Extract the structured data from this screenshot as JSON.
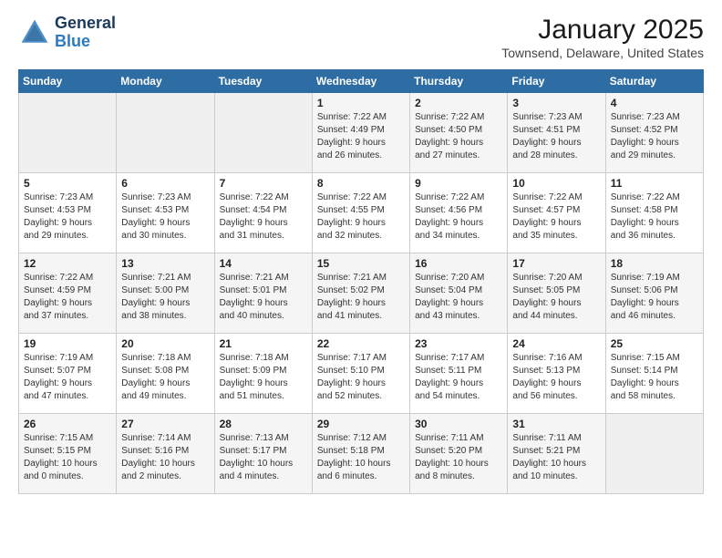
{
  "header": {
    "logo_general": "General",
    "logo_blue": "Blue",
    "month_title": "January 2025",
    "location": "Townsend, Delaware, United States"
  },
  "weekdays": [
    "Sunday",
    "Monday",
    "Tuesday",
    "Wednesday",
    "Thursday",
    "Friday",
    "Saturday"
  ],
  "weeks": [
    [
      {
        "day": "",
        "info": ""
      },
      {
        "day": "",
        "info": ""
      },
      {
        "day": "",
        "info": ""
      },
      {
        "day": "1",
        "info": "Sunrise: 7:22 AM\nSunset: 4:49 PM\nDaylight: 9 hours\nand 26 minutes."
      },
      {
        "day": "2",
        "info": "Sunrise: 7:22 AM\nSunset: 4:50 PM\nDaylight: 9 hours\nand 27 minutes."
      },
      {
        "day": "3",
        "info": "Sunrise: 7:23 AM\nSunset: 4:51 PM\nDaylight: 9 hours\nand 28 minutes."
      },
      {
        "day": "4",
        "info": "Sunrise: 7:23 AM\nSunset: 4:52 PM\nDaylight: 9 hours\nand 29 minutes."
      }
    ],
    [
      {
        "day": "5",
        "info": "Sunrise: 7:23 AM\nSunset: 4:53 PM\nDaylight: 9 hours\nand 29 minutes."
      },
      {
        "day": "6",
        "info": "Sunrise: 7:23 AM\nSunset: 4:53 PM\nDaylight: 9 hours\nand 30 minutes."
      },
      {
        "day": "7",
        "info": "Sunrise: 7:22 AM\nSunset: 4:54 PM\nDaylight: 9 hours\nand 31 minutes."
      },
      {
        "day": "8",
        "info": "Sunrise: 7:22 AM\nSunset: 4:55 PM\nDaylight: 9 hours\nand 32 minutes."
      },
      {
        "day": "9",
        "info": "Sunrise: 7:22 AM\nSunset: 4:56 PM\nDaylight: 9 hours\nand 34 minutes."
      },
      {
        "day": "10",
        "info": "Sunrise: 7:22 AM\nSunset: 4:57 PM\nDaylight: 9 hours\nand 35 minutes."
      },
      {
        "day": "11",
        "info": "Sunrise: 7:22 AM\nSunset: 4:58 PM\nDaylight: 9 hours\nand 36 minutes."
      }
    ],
    [
      {
        "day": "12",
        "info": "Sunrise: 7:22 AM\nSunset: 4:59 PM\nDaylight: 9 hours\nand 37 minutes."
      },
      {
        "day": "13",
        "info": "Sunrise: 7:21 AM\nSunset: 5:00 PM\nDaylight: 9 hours\nand 38 minutes."
      },
      {
        "day": "14",
        "info": "Sunrise: 7:21 AM\nSunset: 5:01 PM\nDaylight: 9 hours\nand 40 minutes."
      },
      {
        "day": "15",
        "info": "Sunrise: 7:21 AM\nSunset: 5:02 PM\nDaylight: 9 hours\nand 41 minutes."
      },
      {
        "day": "16",
        "info": "Sunrise: 7:20 AM\nSunset: 5:04 PM\nDaylight: 9 hours\nand 43 minutes."
      },
      {
        "day": "17",
        "info": "Sunrise: 7:20 AM\nSunset: 5:05 PM\nDaylight: 9 hours\nand 44 minutes."
      },
      {
        "day": "18",
        "info": "Sunrise: 7:19 AM\nSunset: 5:06 PM\nDaylight: 9 hours\nand 46 minutes."
      }
    ],
    [
      {
        "day": "19",
        "info": "Sunrise: 7:19 AM\nSunset: 5:07 PM\nDaylight: 9 hours\nand 47 minutes."
      },
      {
        "day": "20",
        "info": "Sunrise: 7:18 AM\nSunset: 5:08 PM\nDaylight: 9 hours\nand 49 minutes."
      },
      {
        "day": "21",
        "info": "Sunrise: 7:18 AM\nSunset: 5:09 PM\nDaylight: 9 hours\nand 51 minutes."
      },
      {
        "day": "22",
        "info": "Sunrise: 7:17 AM\nSunset: 5:10 PM\nDaylight: 9 hours\nand 52 minutes."
      },
      {
        "day": "23",
        "info": "Sunrise: 7:17 AM\nSunset: 5:11 PM\nDaylight: 9 hours\nand 54 minutes."
      },
      {
        "day": "24",
        "info": "Sunrise: 7:16 AM\nSunset: 5:13 PM\nDaylight: 9 hours\nand 56 minutes."
      },
      {
        "day": "25",
        "info": "Sunrise: 7:15 AM\nSunset: 5:14 PM\nDaylight: 9 hours\nand 58 minutes."
      }
    ],
    [
      {
        "day": "26",
        "info": "Sunrise: 7:15 AM\nSunset: 5:15 PM\nDaylight: 10 hours\nand 0 minutes."
      },
      {
        "day": "27",
        "info": "Sunrise: 7:14 AM\nSunset: 5:16 PM\nDaylight: 10 hours\nand 2 minutes."
      },
      {
        "day": "28",
        "info": "Sunrise: 7:13 AM\nSunset: 5:17 PM\nDaylight: 10 hours\nand 4 minutes."
      },
      {
        "day": "29",
        "info": "Sunrise: 7:12 AM\nSunset: 5:18 PM\nDaylight: 10 hours\nand 6 minutes."
      },
      {
        "day": "30",
        "info": "Sunrise: 7:11 AM\nSunset: 5:20 PM\nDaylight: 10 hours\nand 8 minutes."
      },
      {
        "day": "31",
        "info": "Sunrise: 7:11 AM\nSunset: 5:21 PM\nDaylight: 10 hours\nand 10 minutes."
      },
      {
        "day": "",
        "info": ""
      }
    ]
  ]
}
